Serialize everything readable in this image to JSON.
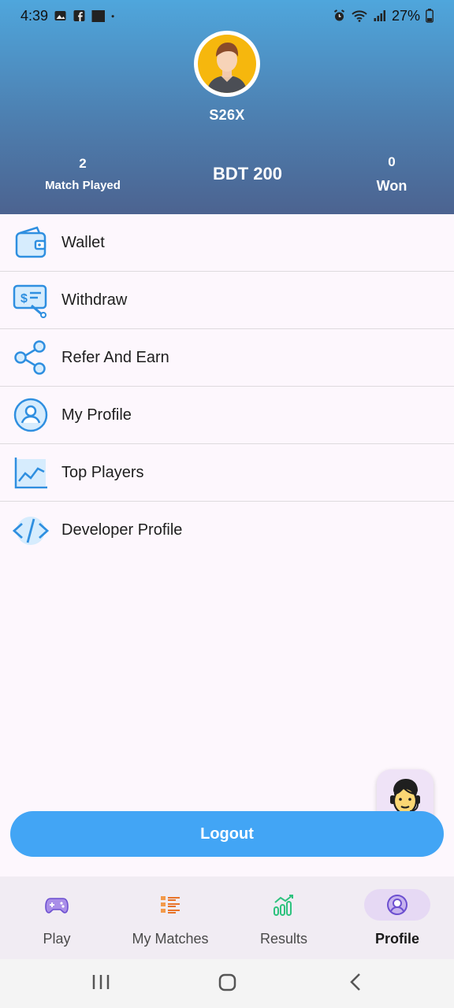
{
  "status_bar": {
    "time": "4:39",
    "battery": "27%"
  },
  "profile": {
    "username": "S26X"
  },
  "stats": {
    "matches_played_value": "2",
    "matches_played_label": "Match Played",
    "balance": "BDT 200",
    "won_value": "0",
    "won_label": "Won"
  },
  "menu": {
    "items": [
      {
        "label": "Wallet",
        "icon": "wallet-icon"
      },
      {
        "label": "Withdraw",
        "icon": "withdraw-icon"
      },
      {
        "label": "Refer And Earn",
        "icon": "share-icon"
      },
      {
        "label": "My Profile",
        "icon": "user-icon"
      },
      {
        "label": "Top Players",
        "icon": "chart-icon"
      },
      {
        "label": "Developer Profile",
        "icon": "code-icon"
      }
    ]
  },
  "actions": {
    "logout_label": "Logout"
  },
  "bottom_nav": {
    "items": [
      {
        "label": "Play",
        "icon": "gamepad-icon"
      },
      {
        "label": "My Matches",
        "icon": "list-icon"
      },
      {
        "label": "Results",
        "icon": "results-icon"
      },
      {
        "label": "Profile",
        "icon": "profile-icon",
        "active": true
      }
    ]
  },
  "colors": {
    "accent": "#42a5f5",
    "header_top": "#4fa6dc",
    "header_bottom": "#4c6390",
    "icon_blue": "#2f8fe0"
  }
}
